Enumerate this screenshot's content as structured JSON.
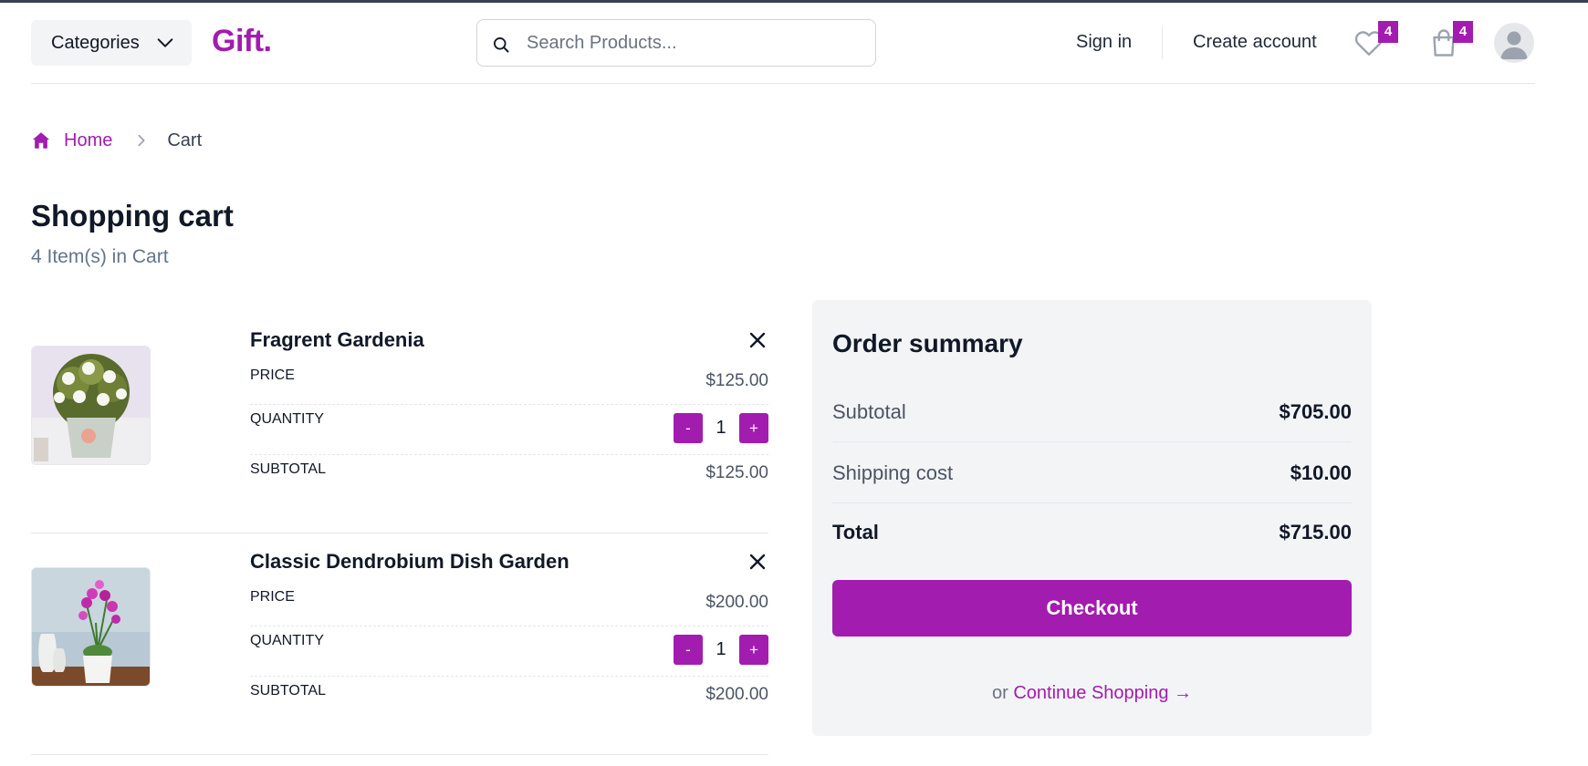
{
  "header": {
    "categories_label": "Categories",
    "logo": "Gift.",
    "search_placeholder": "Search Products...",
    "signin_label": "Sign in",
    "create_account_label": "Create account",
    "wishlist_count": "4",
    "cart_count": "4"
  },
  "breadcrumb": {
    "home_label": "Home",
    "current_label": "Cart"
  },
  "page": {
    "title": "Shopping cart",
    "item_count": "4 Item(s) in Cart"
  },
  "cart": {
    "labels": {
      "price": "PRICE",
      "quantity": "QUANTITY",
      "subtotal": "SUBTOTAL"
    },
    "items": [
      {
        "name": "Fragrent Gardenia",
        "price": "$125.00",
        "quantity": "1",
        "subtotal": "$125.00",
        "minus": "-",
        "plus": "+"
      },
      {
        "name": "Classic Dendrobium Dish Garden",
        "price": "$200.00",
        "quantity": "1",
        "subtotal": "$200.00",
        "minus": "-",
        "plus": "+"
      }
    ]
  },
  "summary": {
    "title": "Order summary",
    "subtotal_label": "Subtotal",
    "subtotal_value": "$705.00",
    "shipping_label": "Shipping cost",
    "shipping_value": "$10.00",
    "total_label": "Total",
    "total_value": "$715.00",
    "checkout_label": "Checkout",
    "or_text": "or",
    "continue_label": "Continue Shopping →"
  },
  "colors": {
    "accent": "#a21caf",
    "summary_bg": "#f3f4f6",
    "muted_text": "#64748b"
  },
  "icons": [
    "chevron-down-icon",
    "search-icon",
    "heart-icon",
    "shopping-bag-icon",
    "user-avatar-icon",
    "home-icon",
    "chevron-right-icon",
    "close-icon"
  ]
}
